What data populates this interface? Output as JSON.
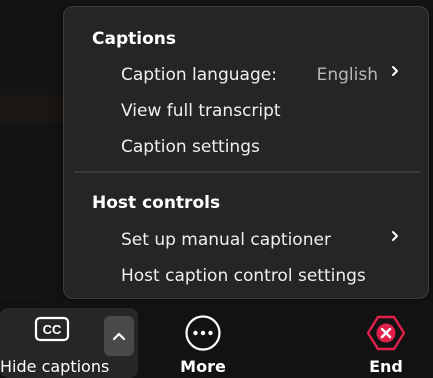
{
  "menu": {
    "captions_section": {
      "title": "Captions",
      "items": [
        {
          "label": "Caption language:",
          "value": "English",
          "has_submenu": true
        },
        {
          "label": "View full transcript"
        },
        {
          "label": "Caption settings"
        }
      ]
    },
    "host_section": {
      "title": "Host controls",
      "items": [
        {
          "label": "Set up manual captioner",
          "has_submenu": true
        },
        {
          "label": "Host caption control settings"
        }
      ]
    }
  },
  "toolbar": {
    "hide_captions_label": "Hide captions",
    "cc_icon_text": "CC",
    "more_label": "More",
    "end_label": "End"
  },
  "colors": {
    "menu_bg": "#252525",
    "end_accent": "#e0204a",
    "toolbar_bg": "#121212"
  },
  "icons": [
    "cc-icon",
    "chevron-up-icon",
    "more-icon",
    "end-icon",
    "chevron-right-icon"
  ]
}
